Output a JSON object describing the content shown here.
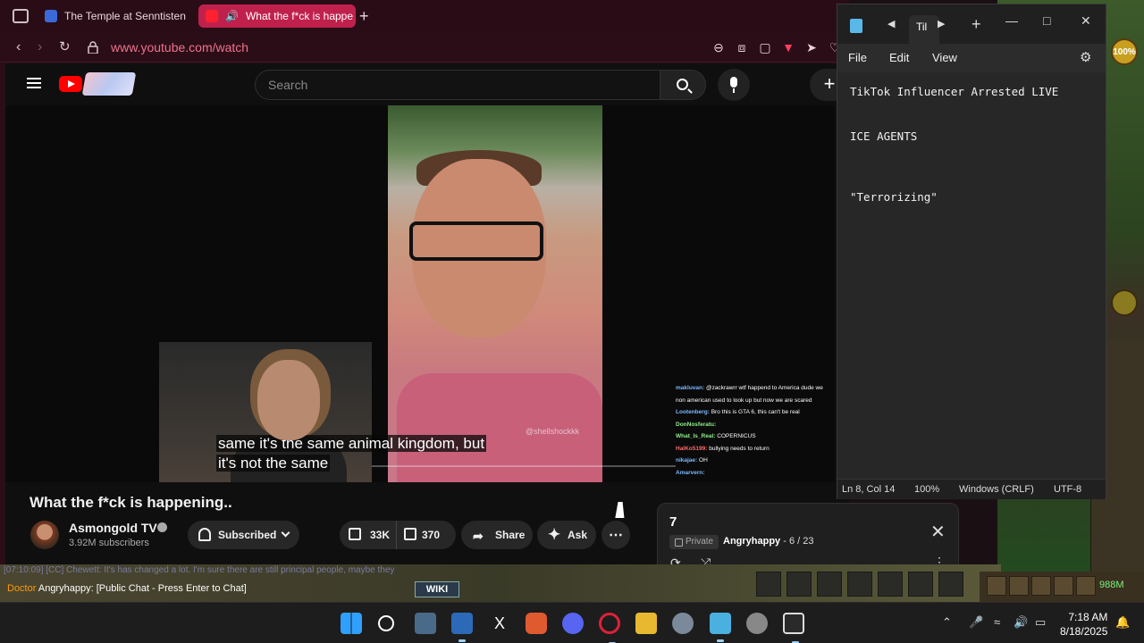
{
  "browser": {
    "tabs": [
      {
        "title": "The Temple at Senntisten",
        "fav_color": "#3a6ad8"
      },
      {
        "title": "What the f*ck is happe",
        "fav_color": "#ff0000"
      }
    ],
    "url": "www.youtube.com/watch",
    "accent": "#c0214c"
  },
  "youtube": {
    "search_placeholder": "Search",
    "create_label": "+",
    "video": {
      "caption_line1": "same it's the same animal kingdom, but",
      "caption_line2": "it's not the same",
      "watermark": "@shellshockkk",
      "chat": [
        {
          "user": "makluvan:",
          "msg": "@zackrawrr wtf happend to America dude we non american used to look up but now we are scared",
          "cls": "u"
        },
        {
          "user": "Lootenberg:",
          "msg": "Bro this is GTA 6, this can't be real",
          "cls": "u"
        },
        {
          "user": "DonNosferatu:",
          "msg": "",
          "cls": "g"
        },
        {
          "user": "What_Is_Real:",
          "msg": "COPERNICUS",
          "cls": "g"
        },
        {
          "user": "HalKo5199:",
          "msg": "bullying needs to return",
          "cls": "r"
        },
        {
          "user": "nikajae:",
          "msg": "OH",
          "cls": "u"
        },
        {
          "user": "Amarvern:",
          "msg": "",
          "cls": "u"
        }
      ]
    },
    "title": "What the f*ck is happening..",
    "channel": {
      "name": "Asmongold TV",
      "subscribers": "3.92M subscribers"
    },
    "actions": {
      "subscribed": "Subscribed",
      "likes": "33K",
      "dislikes": "370",
      "share": "Share",
      "ask": "Ask",
      "more": "⋯"
    },
    "playlist": {
      "title": "7",
      "privacy": "Private",
      "owner": "Angryhappy",
      "position": " - 6 / 23"
    }
  },
  "notepad": {
    "tab_title": "Til",
    "menu": {
      "file": "File",
      "edit": "Edit",
      "view": "View"
    },
    "lines": [
      {
        "text": "TikTok Influencer Arrested LIVE"
      },
      {
        "text": "ICE AGENTS"
      },
      {
        "text": "\"Terrorizing\""
      }
    ],
    "status": {
      "position": "Ln 8, Col 14",
      "zoom": "100%",
      "line_ending": "Windows (CRLF)",
      "encoding": "UTF-8"
    }
  },
  "game": {
    "chat_line1": "[07:10:09] [CC] Chewett: It's has changed a lot. I'm sure there are still principal people, maybe they",
    "chat_prefix": "Doctor",
    "chat_name": "Angryhappy",
    "chat_prompt": ": [Public Chat - Press Enter to Chat]",
    "wiki_label": "WIKI",
    "gp": "988M",
    "orb_value": "100%"
  },
  "taskbar": {
    "time": "7:18 AM",
    "date": "8/18/2025",
    "icons": [
      "windows-start",
      "search",
      "calculator",
      "photos",
      "x-app",
      "brave",
      "discord",
      "opera",
      "file-explorer",
      "settings",
      "notepad",
      "chrome",
      "runelite"
    ]
  }
}
